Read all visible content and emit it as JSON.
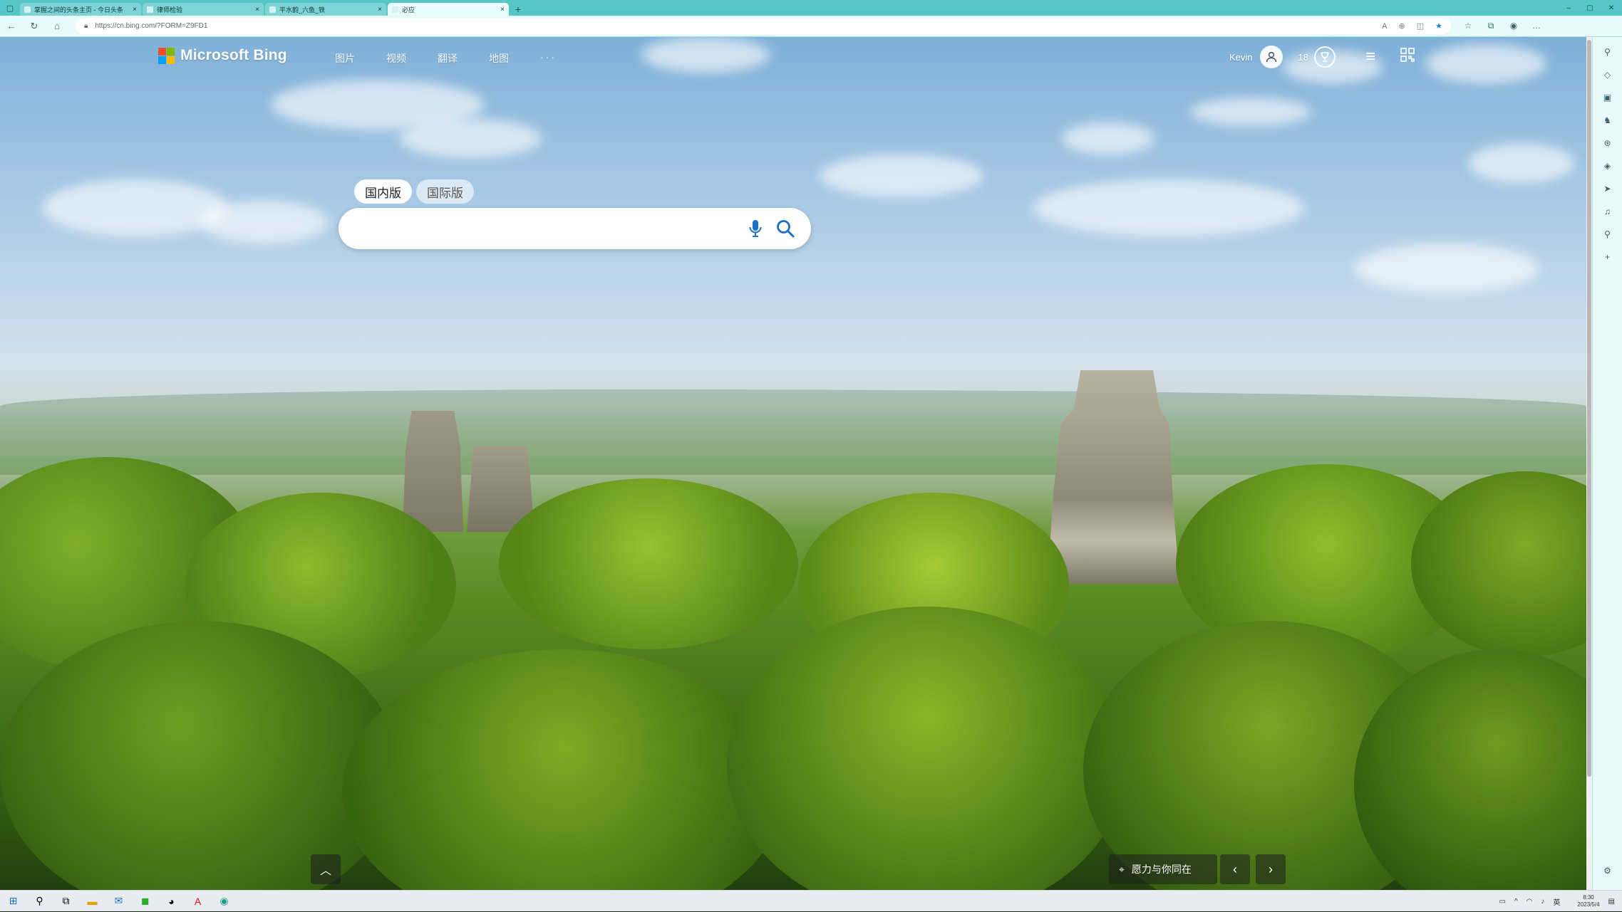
{
  "browser": {
    "tabs": [
      {
        "title": "掌握之间的头条主页 - 今日头条",
        "active": false
      },
      {
        "title": "律师检验",
        "active": false
      },
      {
        "title": "平水韵_六鱼_铁",
        "active": false
      },
      {
        "title": "必应",
        "active": true
      }
    ],
    "url": "https://cn.bing.com/?FORM=Z9FD1"
  },
  "bing": {
    "logo_text": "Microsoft Bing",
    "logo_colors": [
      "#f25022",
      "#7fba00",
      "#00a4ef",
      "#ffb900"
    ],
    "nav": [
      "图片",
      "视频",
      "翻译",
      "地图"
    ],
    "nav_more": "···",
    "user_name": "Kevin",
    "points": "18",
    "search_scopes": [
      "国内版",
      "国际版"
    ],
    "active_scope": "国内版",
    "search_value": "",
    "image_caption": "愿力与你同在"
  },
  "taskbar": {
    "tray_language": "英",
    "clock_time": "8:30",
    "clock_date": "2023/5/4"
  },
  "icons": {
    "user": "user-icon",
    "reward": "trophy-icon",
    "menu": "hamburger-icon",
    "qr": "qr-code-icon",
    "mic": "microphone-icon",
    "search": "search-icon"
  }
}
